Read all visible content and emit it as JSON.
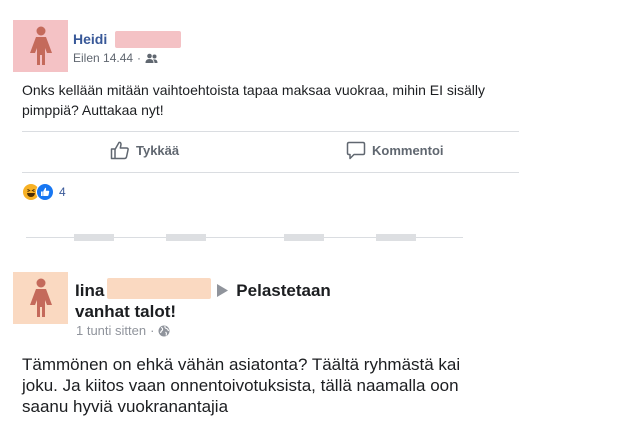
{
  "post1": {
    "author": "Heidi",
    "time": "Eilen 14.44",
    "dot": "·",
    "audience_icon": "friends-icon",
    "text": "Onks kellään mitään vaihtoehtoista tapaa maksaa vuokraa, mihin EI sisälly pimppiä? Auttakaa nyt!",
    "actions": {
      "like_label": "Tykkää",
      "comment_label": "Kommentoi"
    },
    "reactions": {
      "icons": [
        "haha-icon",
        "like-icon"
      ],
      "count": "4"
    }
  },
  "post2": {
    "author": "Iina",
    "group": "Pelastetaan vanhat talot!",
    "time": "1 tunti sitten",
    "dot": "·",
    "audience_icon": "globe-icon",
    "text": "Tämmönen on ehkä vähän asiatonta? Täältä ryhmästä kai joku. Ja kiitos vaan onnentoivotuksista, tällä naamalla oon saanu hyviä vuokranantajia"
  },
  "colors": {
    "link_blue": "#385898",
    "redaction_pink": "#f4c2c5",
    "redaction_peach": "#fad9c1",
    "like_blue": "#1877f2",
    "haha_yellow": "#f7b125"
  }
}
